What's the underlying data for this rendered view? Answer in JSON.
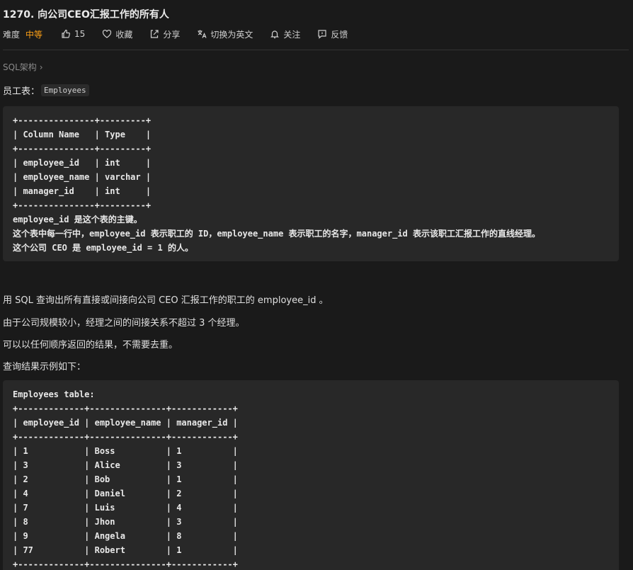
{
  "header": {
    "title": "1270. 向公司CEO汇报工作的所有人",
    "difficulty_label": "难度",
    "difficulty": "中等",
    "likes": "15",
    "favorite": "收藏",
    "share": "分享",
    "switch_lang": "切换为英文",
    "follow": "关注",
    "feedback": "反馈"
  },
  "breadcrumb": {
    "text": "SQL架构"
  },
  "intro": {
    "label": "员工表：",
    "table_name": "Employees"
  },
  "schema_block": "+---------------+---------+\n| Column Name   | Type    |\n+---------------+---------+\n| employee_id   | int     |\n| employee_name | varchar |\n| manager_id    | int     |\n+---------------+---------+\nemployee_id 是这个表的主键。\n这个表中每一行中，employee_id 表示职工的 ID，employee_name 表示职工的名字，manager_id 表示该职工汇报工作的直线经理。\n这个公司 CEO 是 employee_id = 1 的人。",
  "paragraphs": [
    "用 SQL 查询出所有直接或间接向公司 CEO 汇报工作的职工的 employee_id 。",
    "由于公司规模较小，经理之间的间接关系不超过 3 个经理。",
    "可以以任何顺序返回的结果，不需要去重。",
    "查询结果示例如下："
  ],
  "example_block": "Employees table:\n+-------------+---------------+------------+\n| employee_id | employee_name | manager_id |\n+-------------+---------------+------------+\n| 1           | Boss          | 1          |\n| 3           | Alice         | 3          |\n| 2           | Bob           | 1          |\n| 4           | Daniel        | 2          |\n| 7           | Luis          | 4          |\n| 8           | Jhon          | 3          |\n| 9           | Angela        | 8          |\n| 77          | Robert        | 1          |\n+-------------+---------------+------------+",
  "colors": {
    "accent": "#ffa116",
    "background": "#1a1a1a",
    "code_bg": "#282828"
  }
}
